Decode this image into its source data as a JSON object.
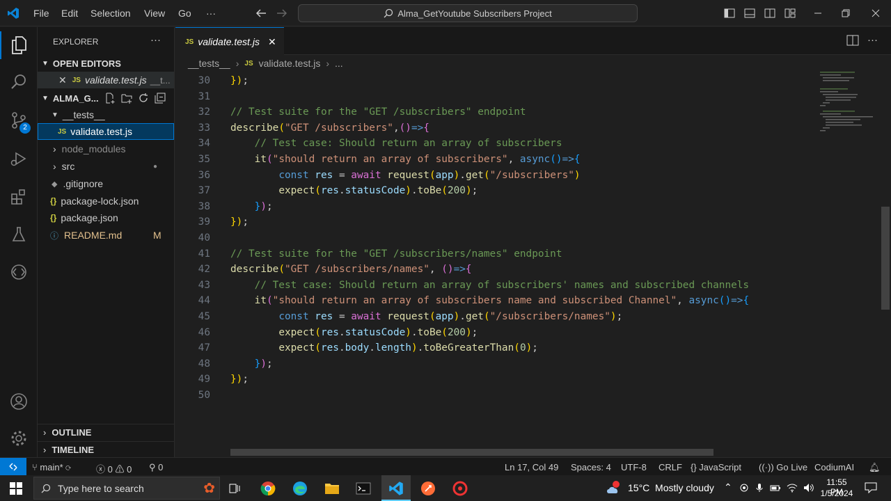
{
  "titlebar": {
    "menu": [
      "File",
      "Edit",
      "Selection",
      "View",
      "Go",
      "···"
    ],
    "search": "Alma_GetYoutube Subscribers Project"
  },
  "sidebar": {
    "title": "EXPLORER",
    "more": "···",
    "open_editors": "OPEN EDITORS",
    "open_file": "validate.test.js",
    "open_file_path": "__t...",
    "project": "ALMA_G...",
    "folder_tests": "__tests__",
    "file_active": "validate.test.js",
    "items": [
      {
        "label": "node_modules",
        "badge": ""
      },
      {
        "label": "src",
        "badge": "●"
      },
      {
        "label": ".gitignore",
        "badge": ""
      },
      {
        "label": "package-lock.json",
        "badge": ""
      },
      {
        "label": "package.json",
        "badge": ""
      },
      {
        "label": "README.md",
        "badge": "M"
      }
    ],
    "outline": "OUTLINE",
    "timeline": "TIMELINE"
  },
  "activity": {
    "scm_badge": "2"
  },
  "editor": {
    "tab": "validate.test.js",
    "breadcrumb": [
      "__tests__",
      "validate.test.js",
      "..."
    ],
    "lines": [
      {
        "n": "30",
        "t": [
          [
            "y",
            "})"
          ],
          [
            "",
            "; "
          ]
        ]
      },
      {
        "n": "31",
        "t": []
      },
      {
        "n": "32",
        "t": [
          [
            "cm",
            "// Test suite for the \"GET /subscribers\" endpoint"
          ]
        ]
      },
      {
        "n": "33",
        "t": [
          [
            "fn",
            "describe"
          ],
          [
            "y",
            "("
          ],
          [
            "st",
            "\"GET /subscribers\""
          ],
          [
            "",
            ","
          ],
          [
            "p",
            "()"
          ],
          [
            "kw",
            "=>"
          ],
          [
            "p",
            "{"
          ]
        ]
      },
      {
        "n": "34",
        "t": [
          [
            "",
            "    "
          ],
          [
            "cm",
            "// Test case: Should return an array of subscribers"
          ]
        ]
      },
      {
        "n": "35",
        "t": [
          [
            "",
            "    "
          ],
          [
            "fn",
            "it"
          ],
          [
            "p",
            "("
          ],
          [
            "st",
            "\"should return an array of subscribers\""
          ],
          [
            "",
            ", "
          ],
          [
            "kw",
            "async"
          ],
          [
            "b",
            "()"
          ],
          [
            "kw",
            "=>"
          ],
          [
            "b",
            "{"
          ]
        ]
      },
      {
        "n": "36",
        "t": [
          [
            "",
            "        "
          ],
          [
            "kw",
            "const "
          ],
          [
            "vr",
            "res"
          ],
          [
            "",
            " = "
          ],
          [
            "p",
            "await "
          ],
          [
            "fn",
            "request"
          ],
          [
            "y",
            "("
          ],
          [
            "vr",
            "app"
          ],
          [
            "y",
            ")"
          ],
          [
            "",
            "."
          ],
          [
            "fn",
            "get"
          ],
          [
            "y",
            "("
          ],
          [
            "st",
            "\"/subscribers\""
          ],
          [
            "y",
            ")"
          ]
        ]
      },
      {
        "n": "37",
        "t": [
          [
            "",
            "        "
          ],
          [
            "fn",
            "expect"
          ],
          [
            "y",
            "("
          ],
          [
            "vr",
            "res"
          ],
          [
            "",
            "."
          ],
          [
            "vr",
            "statusCode"
          ],
          [
            "y",
            ")"
          ],
          [
            "",
            "."
          ],
          [
            "fn",
            "toBe"
          ],
          [
            "y",
            "("
          ],
          [
            "nm",
            "200"
          ],
          [
            "y",
            ")"
          ],
          [
            "",
            ";"
          ]
        ]
      },
      {
        "n": "38",
        "t": [
          [
            "",
            "    "
          ],
          [
            "b",
            "}"
          ],
          [
            "p",
            ")"
          ],
          [
            "",
            ";"
          ]
        ]
      },
      {
        "n": "39",
        "t": [
          [
            "y",
            "})"
          ],
          [
            "",
            ";"
          ]
        ]
      },
      {
        "n": "40",
        "t": []
      },
      {
        "n": "41",
        "t": [
          [
            "cm",
            "// Test suite for the \"GET /subscribers/names\" endpoint"
          ]
        ]
      },
      {
        "n": "42",
        "t": [
          [
            "fn",
            "describe"
          ],
          [
            "y",
            "("
          ],
          [
            "st",
            "\"GET /subscribers/names\""
          ],
          [
            "",
            ", "
          ],
          [
            "p",
            "()"
          ],
          [
            "kw",
            "=>"
          ],
          [
            "p",
            "{"
          ]
        ]
      },
      {
        "n": "43",
        "t": [
          [
            "",
            "    "
          ],
          [
            "cm",
            "// Test case: Should return an array of subscribers' names and subscribed channels"
          ]
        ]
      },
      {
        "n": "44",
        "t": [
          [
            "",
            "    "
          ],
          [
            "fn",
            "it"
          ],
          [
            "p",
            "("
          ],
          [
            "st",
            "\"should return an array of subscribers name and subscribed Channel\""
          ],
          [
            "",
            ", "
          ],
          [
            "kw",
            "async"
          ],
          [
            "b",
            "()"
          ],
          [
            "kw",
            "=>"
          ],
          [
            "b",
            "{"
          ]
        ]
      },
      {
        "n": "45",
        "t": [
          [
            "",
            "        "
          ],
          [
            "kw",
            "const "
          ],
          [
            "vr",
            "res"
          ],
          [
            "",
            " = "
          ],
          [
            "p",
            "await "
          ],
          [
            "fn",
            "request"
          ],
          [
            "y",
            "("
          ],
          [
            "vr",
            "app"
          ],
          [
            "y",
            ")"
          ],
          [
            "",
            "."
          ],
          [
            "fn",
            "get"
          ],
          [
            "y",
            "("
          ],
          [
            "st",
            "\"/subscribers/names\""
          ],
          [
            "y",
            ")"
          ],
          [
            "",
            ";"
          ]
        ]
      },
      {
        "n": "46",
        "t": [
          [
            "",
            "        "
          ],
          [
            "fn",
            "expect"
          ],
          [
            "y",
            "("
          ],
          [
            "vr",
            "res"
          ],
          [
            "",
            "."
          ],
          [
            "vr",
            "statusCode"
          ],
          [
            "y",
            ")"
          ],
          [
            "",
            "."
          ],
          [
            "fn",
            "toBe"
          ],
          [
            "y",
            "("
          ],
          [
            "nm",
            "200"
          ],
          [
            "y",
            ")"
          ],
          [
            "",
            ";"
          ]
        ]
      },
      {
        "n": "47",
        "t": [
          [
            "",
            "        "
          ],
          [
            "fn",
            "expect"
          ],
          [
            "y",
            "("
          ],
          [
            "vr",
            "res"
          ],
          [
            "",
            "."
          ],
          [
            "vr",
            "body"
          ],
          [
            "",
            "."
          ],
          [
            "vr",
            "length"
          ],
          [
            "y",
            ")"
          ],
          [
            "",
            "."
          ],
          [
            "fn",
            "toBeGreaterThan"
          ],
          [
            "y",
            "("
          ],
          [
            "nm",
            "0"
          ],
          [
            "y",
            ")"
          ],
          [
            "",
            ";"
          ]
        ]
      },
      {
        "n": "48",
        "t": [
          [
            "",
            "    "
          ],
          [
            "b",
            "}"
          ],
          [
            "p",
            ")"
          ],
          [
            "",
            ";"
          ]
        ]
      },
      {
        "n": "49",
        "t": [
          [
            "y",
            "})"
          ],
          [
            "",
            ";"
          ]
        ]
      },
      {
        "n": "50",
        "t": []
      }
    ]
  },
  "status": {
    "branch": "main*",
    "errors": "0",
    "warnings": "0",
    "ports": "0",
    "position": "Ln 17, Col 49",
    "spaces": "Spaces: 4",
    "encoding": "UTF-8",
    "eol": "CRLF",
    "language": "JavaScript",
    "golive": "Go Live",
    "ai": "CodiumAI"
  },
  "taskbar": {
    "search": "Type here to search",
    "weather": "15°C  Mostly cloudy",
    "time": "11:55 PM",
    "date": "1/5/2024"
  },
  "colors": {
    "accent": "#0078d4",
    "background": "#1f1f1f",
    "sidebar": "#181818"
  }
}
